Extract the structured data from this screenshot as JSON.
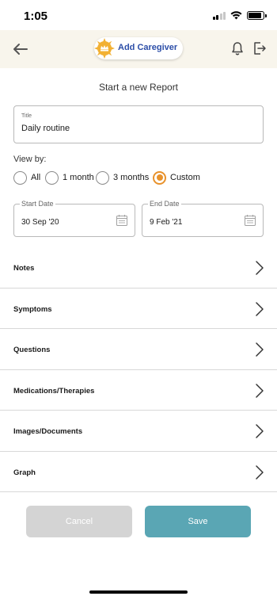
{
  "status_bar": {
    "time": "1:05",
    "signal_bars_active": 2,
    "signal_bars_total": 4,
    "battery_level": 0.9
  },
  "header": {
    "back_icon": "arrow-left-icon",
    "caregiver_button_label": "Add Caregiver",
    "caregiver_icon": "sun-badge-icon",
    "notification_icon": "bell-icon",
    "logout_icon": "logout-icon"
  },
  "page": {
    "subtitle": "Start a new Report"
  },
  "title_field": {
    "label": "Title",
    "value": "Daily routine"
  },
  "view_by": {
    "label": "View by:",
    "options": [
      "All",
      "1 month",
      "3 months",
      "Custom"
    ],
    "selected": "Custom"
  },
  "dates": {
    "start_label": "Start Date",
    "start_value": "30 Sep '20",
    "end_label": "End Date",
    "end_value": "9 Feb '21",
    "calendar_icon": "calendar-icon"
  },
  "sections": [
    {
      "label": "Notes"
    },
    {
      "label": "Symptoms"
    },
    {
      "label": "Questions"
    },
    {
      "label": "Medications/Therapies"
    },
    {
      "label": "Images/Documents"
    },
    {
      "label": "Graph"
    }
  ],
  "actions": {
    "cancel_label": "Cancel",
    "save_label": "Save"
  },
  "colors": {
    "accent_orange": "#e8922c",
    "save_button": "#5aa6b4",
    "cancel_button": "#d4d4d4",
    "header_background": "#f8f5ec",
    "caregiver_text": "#2c4ea8"
  }
}
